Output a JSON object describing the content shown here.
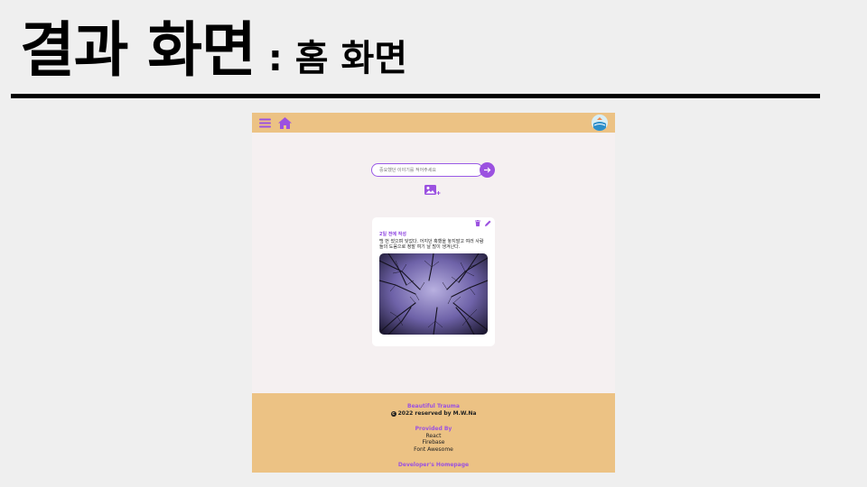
{
  "slide": {
    "title_main": "결과 화면",
    "title_sub": ": 홈 화면"
  },
  "header": {
    "icons": [
      "menu-icon",
      "home-icon",
      "profile-logo"
    ]
  },
  "search": {
    "placeholder": "중요했던 이야기를 적어주세요"
  },
  "post": {
    "date": "2일 전에 작성",
    "text": "백 번 썼으며 잊었다. 어지던 혹했을 놓지말고 여러 사람들의 도움으로 정말 여기 날 많이 생겨난다."
  },
  "footer": {
    "app_name": "Beautiful Trauma",
    "copyright": "2022 reserved by M.W.Na",
    "provided_by": "Provided By",
    "providers": [
      "React",
      "Firebase",
      "Font Awesome"
    ],
    "homepage_label": "Developer's Homepage"
  },
  "colors": {
    "accent": "#9b51e0",
    "header_bg": "#ecc284",
    "app_bg": "#f5f0f1"
  }
}
